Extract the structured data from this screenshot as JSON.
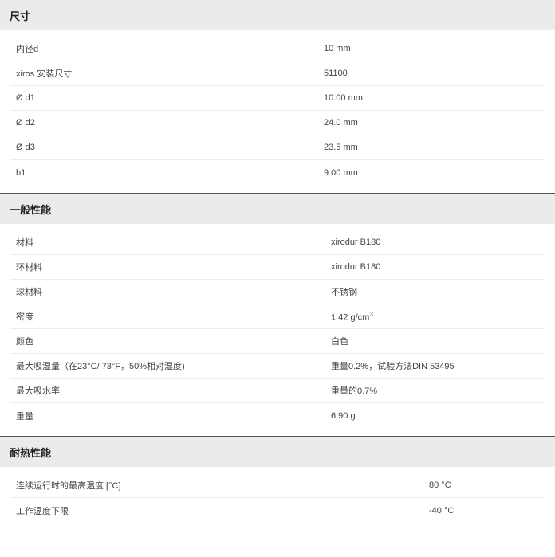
{
  "sections": [
    {
      "title": "尺寸",
      "rows": [
        {
          "label": "内径d",
          "value": "10 mm"
        },
        {
          "label": "xiros 安装尺寸",
          "value": "51100"
        },
        {
          "label": "Ø d1",
          "value": "10.00 mm"
        },
        {
          "label": "Ø d2",
          "value": "24.0 mm"
        },
        {
          "label": "Ø d3",
          "value": "23.5 mm"
        },
        {
          "label": "b1",
          "value": "9.00 mm"
        }
      ]
    },
    {
      "title": "一般性能",
      "rows": [
        {
          "label": "材料",
          "value": "xirodur B180"
        },
        {
          "label": "环材料",
          "value": "xirodur B180"
        },
        {
          "label": "球材料",
          "value": "不锈钢"
        },
        {
          "label": "密度",
          "value": "1.42 g/cm",
          "sup": "3"
        },
        {
          "label": "颜色",
          "value": "白色"
        },
        {
          "label": "最大吸湿量（在23°C/ 73°F，50%相对湿度)",
          "value": "重量0.2%，试验方法DIN 53495"
        },
        {
          "label": "最大吸水率",
          "value": "重量的0.7%"
        },
        {
          "label": "重量",
          "value": "6.90 g"
        }
      ]
    },
    {
      "title": "耐热性能",
      "rows": [
        {
          "label": "连续运行时的最高温度 [°C]",
          "value": "80 °C"
        },
        {
          "label": "工作温度下限",
          "value": "-40 °C"
        }
      ]
    }
  ]
}
